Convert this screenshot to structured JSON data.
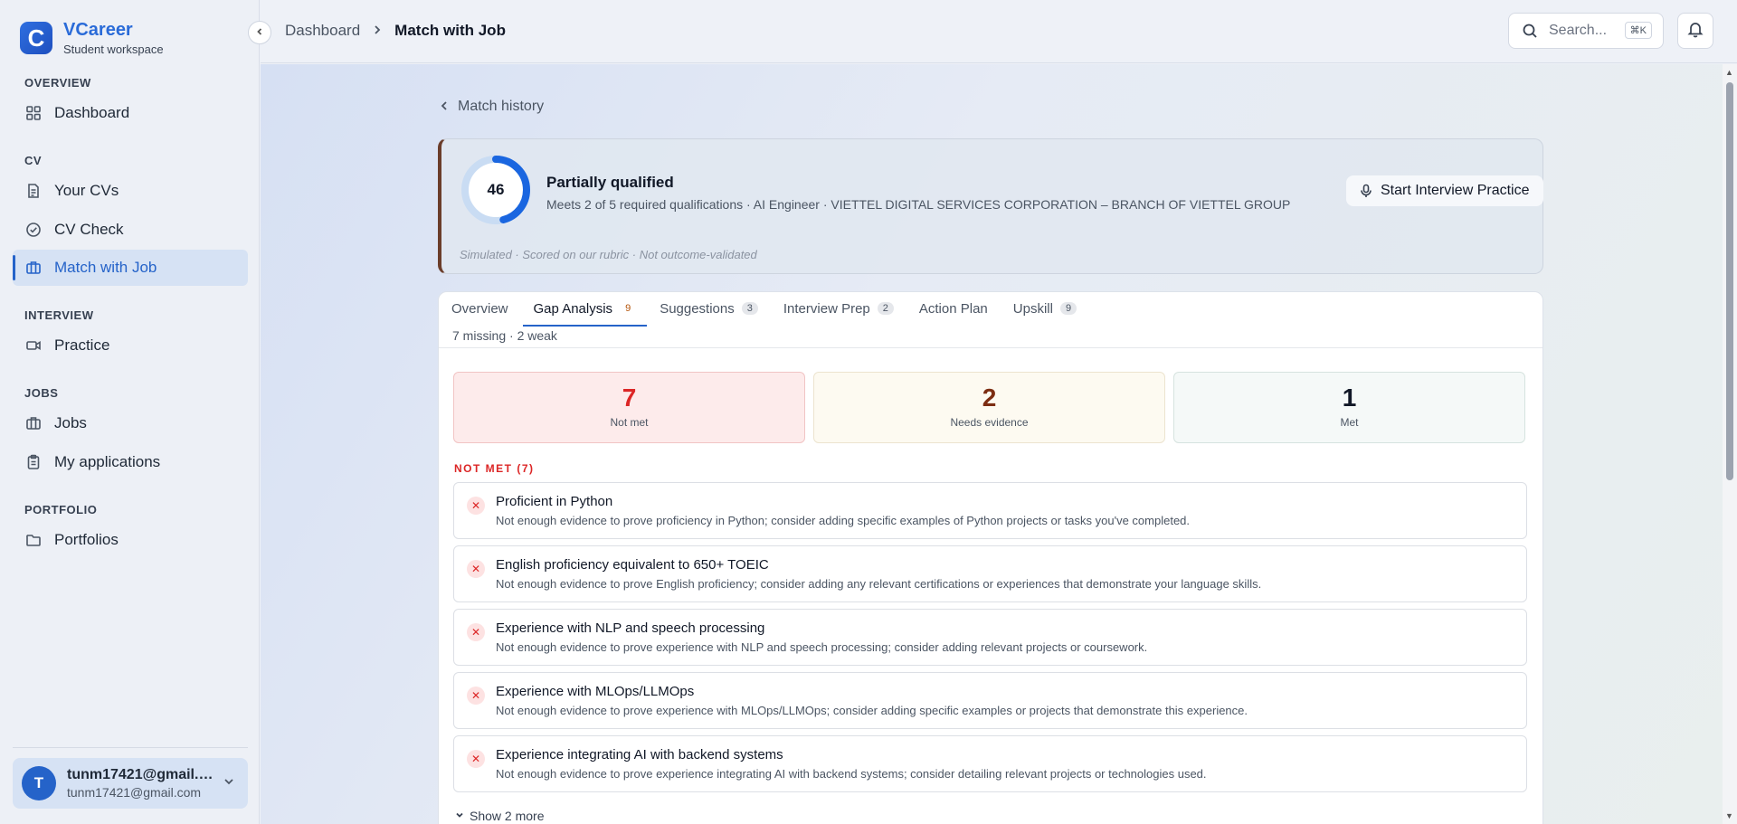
{
  "brand": {
    "logo_letter": "C",
    "name": "VCareer",
    "subtitle": "Student workspace"
  },
  "sidebar": {
    "sections": [
      {
        "label": "OVERVIEW"
      },
      {
        "label": "CV"
      },
      {
        "label": "INTERVIEW"
      },
      {
        "label": "JOBS"
      },
      {
        "label": "PORTFOLIO"
      }
    ],
    "items": [
      {
        "label": "Dashboard",
        "icon": "grid-icon"
      },
      {
        "label": "Your CVs",
        "icon": "file-icon"
      },
      {
        "label": "CV Check",
        "icon": "check-circle-icon"
      },
      {
        "label": "Match with Job",
        "icon": "briefcase-icon",
        "active": true
      },
      {
        "label": "Practice",
        "icon": "video-icon"
      },
      {
        "label": "Jobs",
        "icon": "briefcase-icon"
      },
      {
        "label": "My applications",
        "icon": "clipboard-icon"
      },
      {
        "label": "Portfolios",
        "icon": "folder-icon"
      }
    ]
  },
  "user": {
    "avatar_letter": "T",
    "name": "tunm17421@gmail.com",
    "email": "tunm17421@gmail.com"
  },
  "header": {
    "breadcrumb": [
      "Dashboard",
      "Match with Job"
    ],
    "search_placeholder": "Search...",
    "search_shortcut": "⌘K"
  },
  "back_link": "Match history",
  "score": {
    "value": 46,
    "fraction": 0.46,
    "status": "Partially qualified",
    "summary": "Meets 2 of 5 required qualifications · AI Engineer · VIETTEL DIGITAL SERVICES CORPORATION – BRANCH OF VIETTEL GROUP",
    "note": "Simulated · Scored on our rubric · Not outcome-validated",
    "action_label": "Start Interview Practice",
    "ring_color": "#1a66e0",
    "accent_color": "#6b3d2a"
  },
  "tabs": [
    {
      "label": "Overview",
      "badge": ""
    },
    {
      "label": "Gap Analysis",
      "badge": "9",
      "active": true
    },
    {
      "label": "Suggestions",
      "badge": "3"
    },
    {
      "label": "Interview Prep",
      "badge": "2"
    },
    {
      "label": "Action Plan",
      "badge": ""
    },
    {
      "label": "Upskill",
      "badge": "9"
    }
  ],
  "tab_summary": "7 missing · 2 weak",
  "stats": [
    {
      "value": "7",
      "label": "Not met",
      "color": "#dc2626"
    },
    {
      "value": "2",
      "label": "Needs evidence",
      "color": "#7c2d12"
    },
    {
      "value": "1",
      "label": "Met",
      "color": "#111827"
    }
  ],
  "not_met_label": "NOT MET (7)",
  "gaps": [
    {
      "title": "Proficient in Python",
      "desc": "Not enough evidence to prove proficiency in Python; consider adding specific examples of Python projects or tasks you've completed."
    },
    {
      "title": "English proficiency equivalent to 650+ TOEIC",
      "desc": "Not enough evidence to prove English proficiency; consider adding any relevant certifications or experiences that demonstrate your language skills."
    },
    {
      "title": "Experience with NLP and speech processing",
      "desc": "Not enough evidence to prove experience with NLP and speech processing; consider adding relevant projects or coursework."
    },
    {
      "title": "Experience with MLOps/LLMOps",
      "desc": "Not enough evidence to prove experience with MLOps/LLMOps; consider adding specific examples or projects that demonstrate this experience."
    },
    {
      "title": "Experience integrating AI with backend systems",
      "desc": "Not enough evidence to prove experience integrating AI with backend systems; consider detailing relevant projects or technologies used."
    }
  ],
  "show_more": "Show 2 more"
}
